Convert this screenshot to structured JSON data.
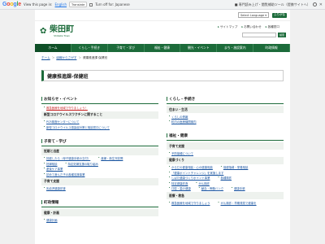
{
  "translate_bar": {
    "logo_letters": [
      "G",
      "o",
      "o",
      "g",
      "l",
      "e"
    ],
    "view_text": "View this page in:",
    "language": "English",
    "translate_btn": "Translate",
    "turn_off_text": "Turn off for: Japanese",
    "right_text": "■ 専門読み上げ・閲覧補助ツール（提携サイトへ）"
  },
  "topstrip": {
    "select_language": "Select Language ▾",
    "furigana": "ふりがな"
  },
  "header": {
    "logo_name": "柴田町",
    "logo_en": "Shibata Town",
    "util_links": [
      "サイトマップ",
      "お問い合わせ",
      "各種窓口"
    ],
    "search_placeholder": "",
    "search_label": "検索"
  },
  "global_nav": [
    "ホーム",
    "くらし・手続き",
    "子育て・学び",
    "福祉・健康",
    "観光・イベント",
    "まち・施設案内",
    "町政情報"
  ],
  "breadcrumb": {
    "items": [
      "ホーム",
      "組織からさがす"
    ],
    "current": "健康推進課 保健班"
  },
  "page_title": "健康推進課-保健班",
  "left_col": {
    "news": {
      "heading": "お知らせ・イベント",
      "items": [
        "救急医療を地域で守りましょう！"
      ],
      "sub_heading": "新型コロナウイルスワクチンに関すること",
      "sub_items": [
        "PCR検査センターについて",
        "新型コロナウイルス感染症対策と相談窓口について"
      ]
    },
    "child": {
      "heading": "子育て・学び",
      "sub_heading": "妊娠と出産",
      "items": [
        "妊娠したら（母子健康手帳の交付）",
        "産婦・新生児訪問",
        "妊婦相談",
        "特定妊婦支援の取り組み",
        "産後ケア事業",
        "初めて産んだ子の各種支援事業"
      ],
      "sub_heading2": "子育て支援",
      "items2": [
        "乳幼児健康診査"
      ]
    },
    "gov": {
      "heading": "町政情報",
      "sub_heading": "健康・計画",
      "items": [
        "健康計画"
      ]
    }
  },
  "right_col": {
    "life": {
      "heading": "くらし・手続き",
      "sub_heading": "住まい・生活",
      "items": [
        "くらしの情報",
        "町内の医療機関案内"
      ]
    },
    "welfare": {
      "heading": "福祉・健康",
      "sub_heading": "子育て支援",
      "items": [
        "予防接種について"
      ],
      "sub_heading2": "健康づくり",
      "items2": [
        "からだの健康相談・心の健康相談",
        "保健指導・栄養相談",
        "「健康ポイントチャレンジ」を実施します",
        "しばた健康づくりポイント事業",
        "各種検診",
        "特定健康診査",
        "がん検診",
        "口腔・歯の健康",
        "献血・骨髄バンク",
        "健康手帳"
      ],
      "sub_heading3": "医療・救急",
      "items3": [
        "救急医療を地域で守りましょう",
        "がん検診・早期発見で健康を"
      ]
    }
  }
}
